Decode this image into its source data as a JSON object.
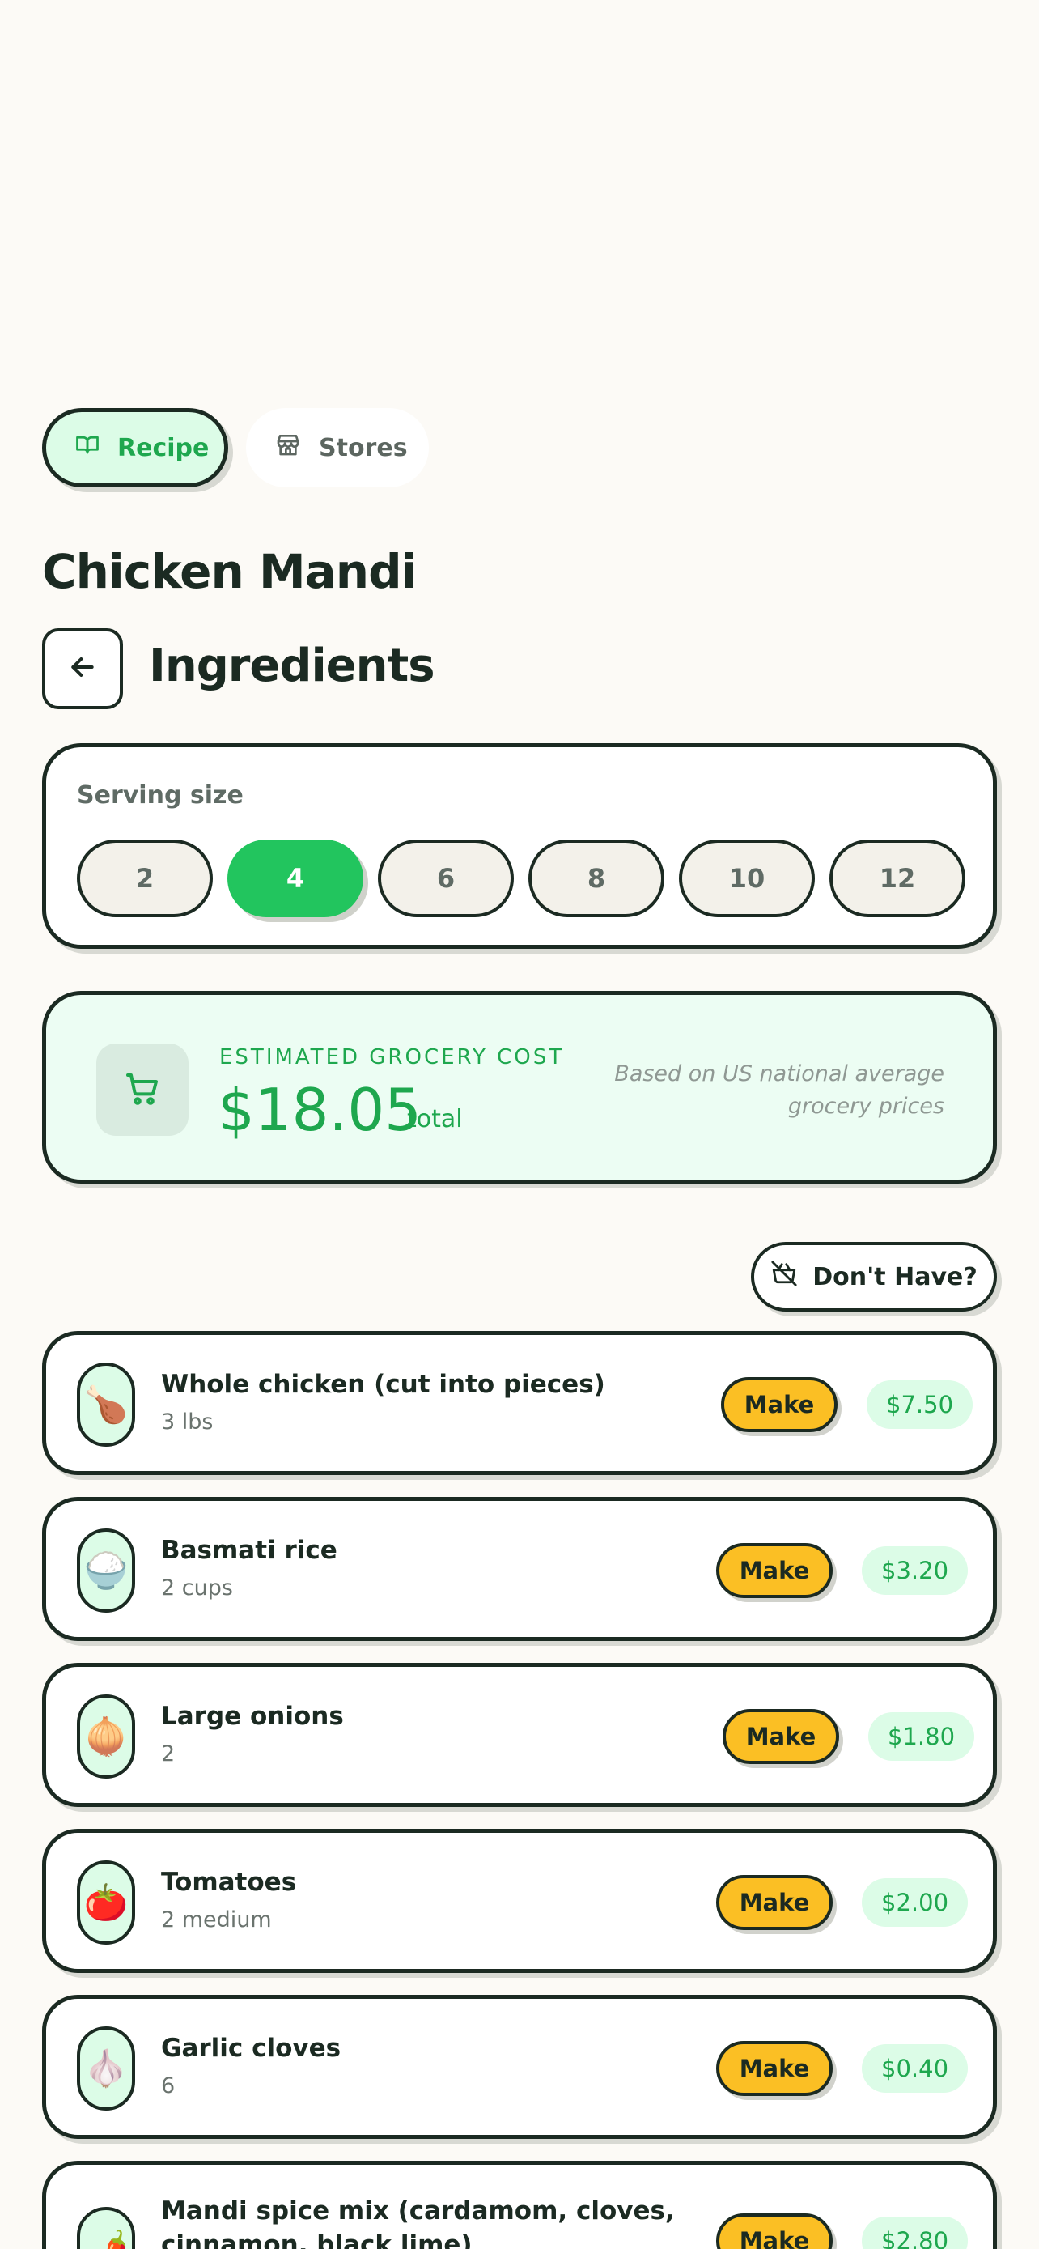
{
  "tabs": {
    "recipe": "Recipe",
    "stores": "Stores"
  },
  "recipe_title": "Chicken Mandi",
  "section_title": "Ingredients",
  "serving": {
    "label": "Serving size",
    "options": [
      "2",
      "4",
      "6",
      "8",
      "10",
      "12"
    ],
    "selected": "4"
  },
  "cost": {
    "label": "ESTIMATED GROCERY COST",
    "value": "$18.05",
    "suffix": "total",
    "note": "Based on US national average grocery prices"
  },
  "dont_have_label": "Don't Have?",
  "ingredients": [
    {
      "icon": "🍗",
      "name": "Whole chicken (cut into pieces)",
      "qty": "3 lbs",
      "make": "Make",
      "price": "$7.50"
    },
    {
      "icon": "🍚",
      "name": "Basmati rice",
      "qty": "2 cups",
      "make": "Make",
      "price": "$3.20"
    },
    {
      "icon": "🧅",
      "name": "Large onions",
      "qty": "2",
      "make": "Make",
      "price": "$1.80"
    },
    {
      "icon": "🍅",
      "name": "Tomatoes",
      "qty": "2 medium",
      "make": "Make",
      "price": "$2.00"
    },
    {
      "icon": "🧄",
      "name": "Garlic cloves",
      "qty": "6",
      "make": "Make",
      "price": "$0.40"
    },
    {
      "icon": "🌶️",
      "name": "Mandi spice mix (cardamom, cloves, cinnamon, black lime)",
      "qty": "",
      "make": "Make",
      "price": "$2.80"
    }
  ],
  "colors": {
    "accent_green": "#22c55e",
    "text_green": "#1ea74e",
    "make_yellow": "#fbbf24",
    "ink": "#1b2a22",
    "background": "#fcfaf6"
  }
}
